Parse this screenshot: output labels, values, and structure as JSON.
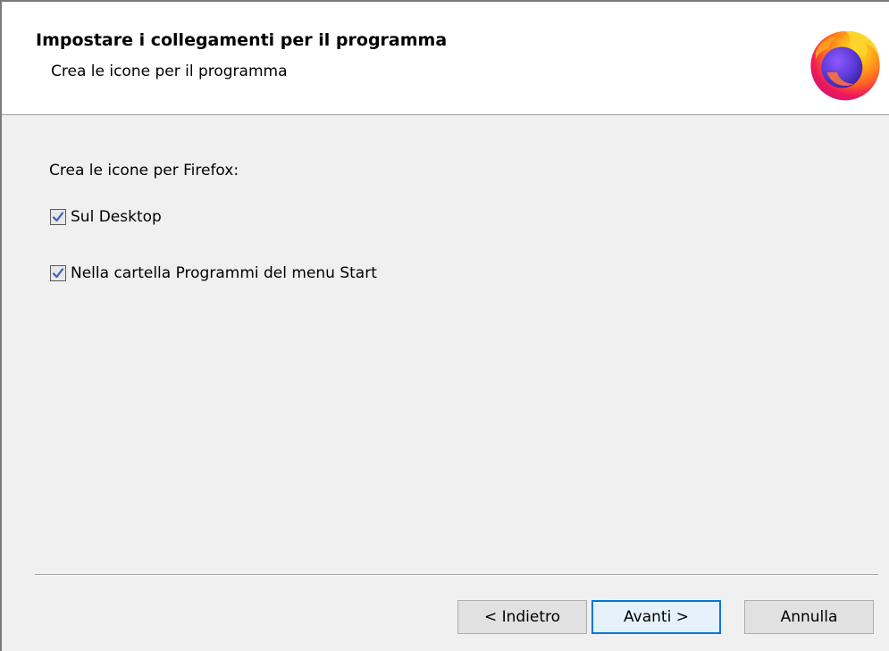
{
  "header": {
    "title": "Impostare i collegamenti per il programma",
    "subtitle": "Crea le icone per il programma",
    "logo": "firefox-logo"
  },
  "content": {
    "label": "Crea le icone per Firefox:",
    "options": [
      {
        "label": "Sul Desktop",
        "checked": true
      },
      {
        "label": "Nella cartella Programmi del menu Start",
        "checked": true
      }
    ]
  },
  "buttons": {
    "back": "< Indietro",
    "next": "Avanti >",
    "cancel": "Annulla"
  },
  "colors": {
    "accent": "#0078d7",
    "header_bg": "#ffffff",
    "body_bg": "#f0f0f0"
  }
}
